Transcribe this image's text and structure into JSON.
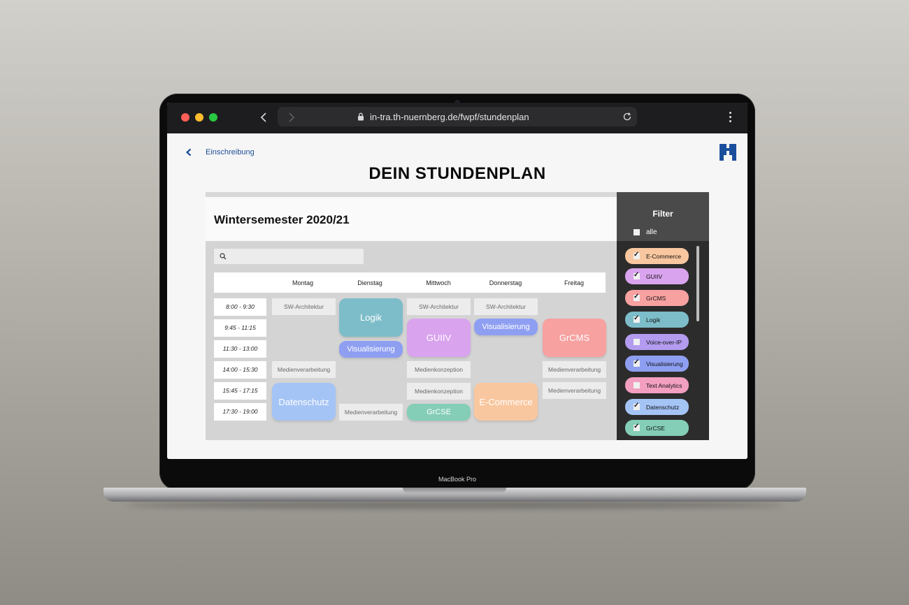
{
  "browser": {
    "url": "in-tra.th-nuernberg.de/fwpf/stundenplan"
  },
  "device": {
    "label": "MacBook Pro"
  },
  "page": {
    "back_label": "Einschreibung",
    "title": "DEIN STUNDENPLAN",
    "semester": "Wintersemester 2020/21",
    "search_placeholder": ""
  },
  "schedule": {
    "days": [
      "Montag",
      "Dienstag",
      "Mittwoch",
      "Donnerstag",
      "Freitag"
    ],
    "times": [
      "8:00 - 9:30",
      "9:45 - 11:15",
      "11:30 - 13:00",
      "14:00 - 15:30",
      "15:45 - 17:15",
      "17:30 - 19:00"
    ],
    "slots": {
      "mon_sw": "SW-Architektur",
      "mon_medien": "Medienverarbeitung",
      "tue_medien": "Medienverarbeitung",
      "wed_sw": "SW-Architektur",
      "wed_konz1": "Medienkonzeption",
      "wed_konz2": "Medienkonzeption",
      "thu_sw": "SW-Architektur",
      "fri_medien1": "Medienverarbeitung",
      "fri_medien2": "Medienverarbeitung"
    },
    "courses": {
      "logik": "Logik",
      "tue_visual": "Visualisierung",
      "guiiv": "GUIIV",
      "thu_visual": "Visualisierung",
      "grcms": "GrCMS",
      "datenschutz": "Datenschutz",
      "grcse": "GrCSE",
      "ecommerce": "E-Commerce"
    }
  },
  "filter": {
    "title": "Filter",
    "all_label": "alle",
    "all_checked": false,
    "items": [
      {
        "label": "E-Commerce",
        "checked": true,
        "color": "#f9c79f"
      },
      {
        "label": "GUIIV",
        "checked": true,
        "color": "#d9a3ee"
      },
      {
        "label": "GrCMS",
        "checked": true,
        "color": "#f7a1a1"
      },
      {
        "label": "Logik",
        "checked": true,
        "color": "#7dbdc9"
      },
      {
        "label": "Voice-over-IP",
        "checked": false,
        "color": "#b39cf0"
      },
      {
        "label": "Visualisierung",
        "checked": true,
        "color": "#8e9ff2"
      },
      {
        "label": "Text Analytics",
        "checked": false,
        "color": "#f29fc0"
      },
      {
        "label": "Datenschutz",
        "checked": true,
        "color": "#a5c4f6"
      },
      {
        "label": "GrCSE",
        "checked": true,
        "color": "#84cdb7"
      }
    ]
  },
  "colors": {
    "ecommerce": "#f9c79f",
    "guiiv": "#d9a3ee",
    "grcms": "#f7a1a1",
    "logik": "#7dbdc9",
    "visualisierung": "#8e9ff2",
    "datenschutz": "#a5c4f6",
    "grcse": "#84cdb7",
    "link": "#1f4e99"
  }
}
